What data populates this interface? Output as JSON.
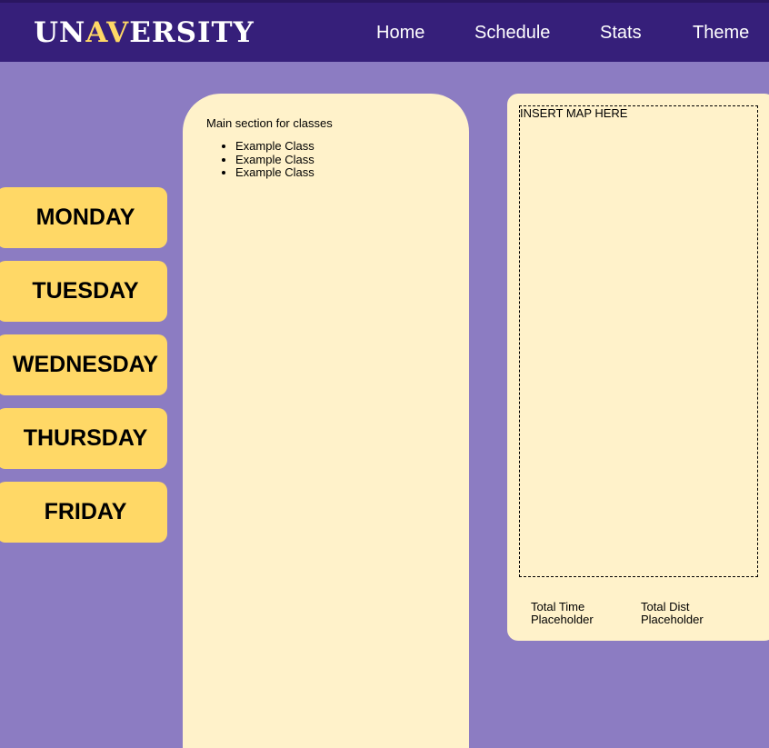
{
  "header": {
    "logo_part1": "UN",
    "logo_part2": "AV",
    "logo_part3": "ERSITY",
    "nav": [
      "Home",
      "Schedule",
      "Stats",
      "Theme"
    ]
  },
  "days": [
    "MONDAY",
    "TUESDAY",
    "WEDNESDAY",
    "THURSDAY",
    "FRIDAY"
  ],
  "main": {
    "intro": "Main section for classes",
    "classes": [
      "Example Class",
      "Example Class",
      "Example Class"
    ]
  },
  "map": {
    "placeholder": "INSERT MAP HERE",
    "total_time_line1": "Total Time",
    "total_time_line2": "Placeholder",
    "total_dist_line1": "Total Dist",
    "total_dist_line2": "Placeholder"
  },
  "colors": {
    "header_bg": "#361f7a",
    "page_bg": "#8c7cc2",
    "accent_yellow": "#ffd866",
    "panel_bg": "#fff2ca"
  }
}
